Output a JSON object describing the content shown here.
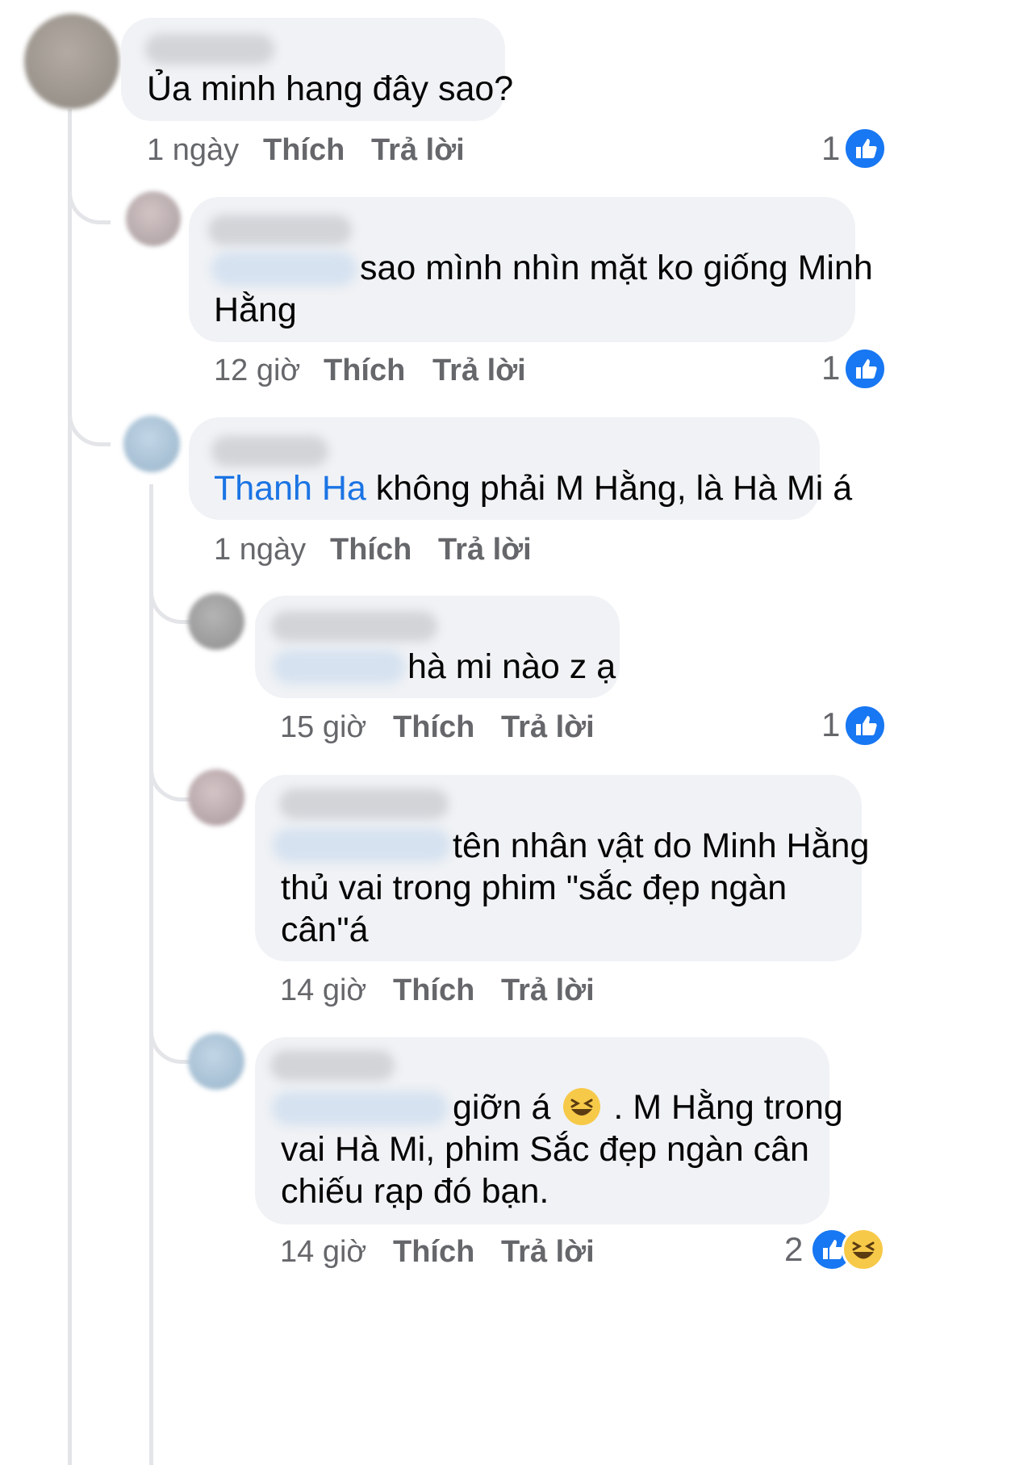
{
  "comments": [
    {
      "text": "Ủa minh hang đây sao?",
      "time": "1 ngày",
      "like": "Thích",
      "reply": "Trả lời",
      "reactions": "1"
    },
    {
      "text": "sao mình nhìn mặt ko giống Minh",
      "text2": "Hằng",
      "time": "12 giờ",
      "like": "Thích",
      "reply": "Trả lời",
      "reactions": "1"
    },
    {
      "mention": "Thanh Ha",
      "text": "không phải M Hằng, là Hà Mi á",
      "time": "1 ngày",
      "like": "Thích",
      "reply": "Trả lời"
    },
    {
      "text": "hà mi nào z ạ",
      "time": "15 giờ",
      "like": "Thích",
      "reply": "Trả lời",
      "reactions": "1"
    },
    {
      "text": "tên nhân vật do Minh Hằng",
      "text2": "thủ vai trong phim \"sắc đẹp ngàn",
      "text3": "cân\"á",
      "time": "14 giờ",
      "like": "Thích",
      "reply": "Trả lời"
    },
    {
      "text": "giỡn á",
      "text_cont": ". M Hằng trong",
      "text2": "vai Hà Mi, phim Sắc đẹp ngàn cân",
      "text3": "chiếu rạp đó bạn.",
      "time": "14 giờ",
      "like": "Thích",
      "reply": "Trả lời",
      "reactions": "2"
    }
  ],
  "colors": {
    "bubble": "#f0f2f5",
    "mention": "#1b74e4",
    "like_blue": "#1877f2",
    "meta": "#65676b"
  },
  "icons": [
    "like-icon",
    "haha-icon",
    "grinning-squint-emoji"
  ]
}
